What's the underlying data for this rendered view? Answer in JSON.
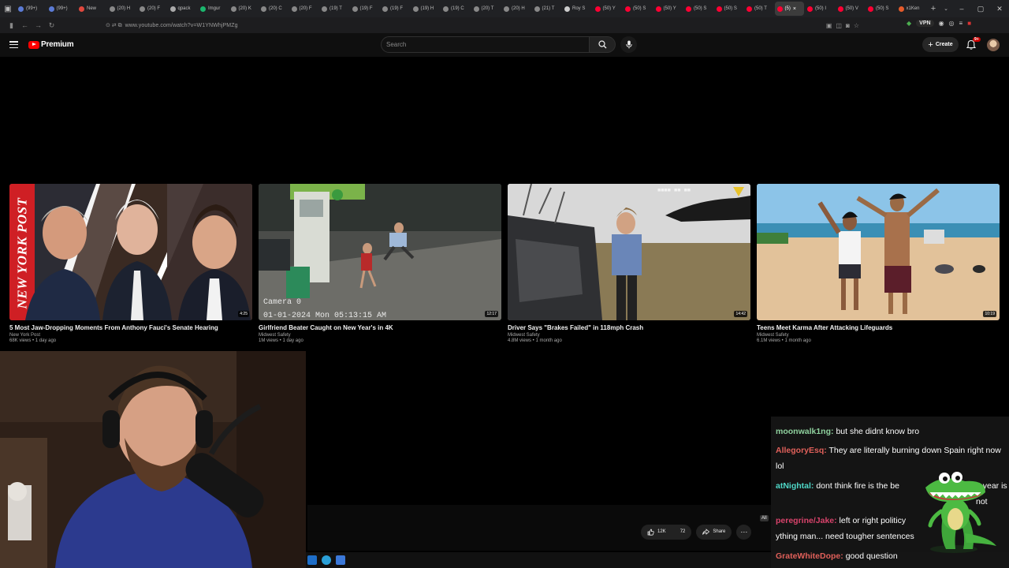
{
  "browser": {
    "tabs": [
      {
        "label": "(99+)",
        "color": "#5b7bd5"
      },
      {
        "label": "(99+)",
        "color": "#5b7bd5"
      },
      {
        "label": "New",
        "color": "#e0483e"
      },
      {
        "label": "(20) H",
        "color": "#888888"
      },
      {
        "label": "(20) F",
        "color": "#888888"
      },
      {
        "label": "qpack",
        "color": "#aaaaaa"
      },
      {
        "label": "Imgur",
        "color": "#1bb76e"
      },
      {
        "label": "(20) K",
        "color": "#888888"
      },
      {
        "label": "(20) C",
        "color": "#888888"
      },
      {
        "label": "(20) F",
        "color": "#888888"
      },
      {
        "label": "(19) T",
        "color": "#888888"
      },
      {
        "label": "(19) F",
        "color": "#888888"
      },
      {
        "label": "(19) F",
        "color": "#888888"
      },
      {
        "label": "(19) H",
        "color": "#888888"
      },
      {
        "label": "(19) C",
        "color": "#888888"
      },
      {
        "label": "(20) T",
        "color": "#888888"
      },
      {
        "label": "(20) H",
        "color": "#888888"
      },
      {
        "label": "(21) T",
        "color": "#888888"
      },
      {
        "label": "Roy S",
        "color": "#cccccc"
      },
      {
        "label": "(50) Y",
        "color": "#ff0033"
      },
      {
        "label": "(50) S",
        "color": "#ff0033"
      },
      {
        "label": "(50) Y",
        "color": "#ff0033"
      },
      {
        "label": "(50) S",
        "color": "#ff0033"
      },
      {
        "label": "(50) S",
        "color": "#ff0033"
      },
      {
        "label": "(50) T",
        "color": "#ff0033"
      },
      {
        "label": "(5)",
        "color": "#ff0033",
        "active": true
      },
      {
        "label": "(50) I",
        "color": "#ff0033"
      },
      {
        "label": "(50) V",
        "color": "#ff0033"
      },
      {
        "label": "(50) S",
        "color": "#ff0033"
      },
      {
        "label": "x1Ken",
        "color": "#e55b2b"
      }
    ],
    "url": "www.youtube.com/watch?v=W1YNWhjPMZg",
    "vpn_label": "VPN"
  },
  "youtube": {
    "logo_text": "Premium",
    "search_placeholder": "Search",
    "create_label": "Create",
    "notif_count": "9+"
  },
  "videos": [
    {
      "title": "5 Most Jaw-Dropping Moments From Anthony Fauci's Senate Hearing",
      "channel": "New York Post",
      "meta": "68K views • 1 day ago",
      "duration": "4:25"
    },
    {
      "title": "Girlfriend Beater Caught on New Year's in 4K",
      "channel": "Midwest Safety",
      "meta": "1M views • 1 day ago",
      "duration": "12:17"
    },
    {
      "title": "Driver Says \"Brakes Failed\" in 118mph Crash",
      "channel": "Midwest Safety",
      "meta": "4.8M views • 1 month ago",
      "duration": "14:42"
    },
    {
      "title": "Teens Meet Karma After Attacking Lifeguards",
      "channel": "Midwest Safety",
      "meta": "6.1M views • 1 month ago",
      "duration": "10:19"
    }
  ],
  "thumb_text": {
    "nyp_logo": "NEW YORK POST",
    "cam_label": "Camera 0",
    "cam_timestamp": "01-01-2024 Mon 05:13:15 AM"
  },
  "player": {
    "like_count": "12K",
    "comment_count": "72",
    "share_label": "Share"
  },
  "chat": {
    "all_label": "All",
    "messages": [
      {
        "user": "moonwalk1ng:",
        "user_color": "#8fd19e",
        "text": "but she didnt know bro"
      },
      {
        "user": "AllegoryEsq:",
        "user_color": "#e0605a",
        "text": "They are literally burning down Spain right now lol"
      },
      {
        "user": "atNightal:",
        "user_color": "#4fd8c8",
        "text": "dont think fire is the be",
        "text2": "1 year is not"
      },
      {
        "user": "peregrine/Jake:",
        "user_color": "#d8436b",
        "text": "left or right politicy",
        "text2": "ything man... need tougher sentences"
      },
      {
        "user": "GrateWhiteDope:",
        "user_color": "#e0605a",
        "text": "good question"
      }
    ]
  }
}
